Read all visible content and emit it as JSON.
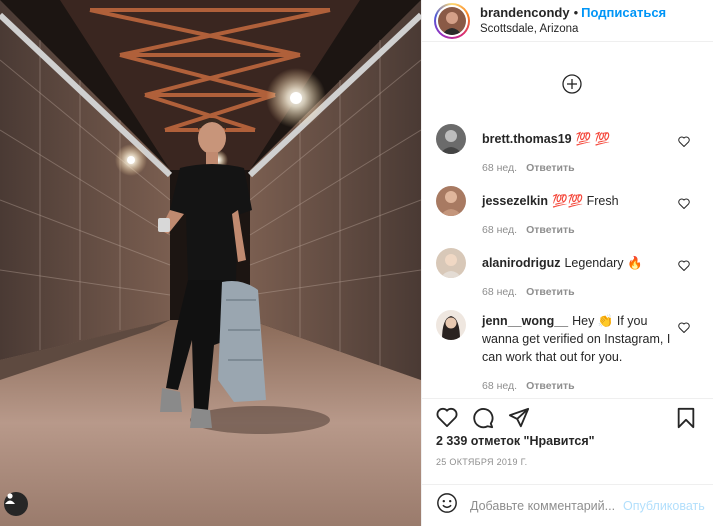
{
  "header": {
    "username": "brandencondy",
    "dot": "•",
    "follow_label": "Подписаться",
    "location": "Scottsdale, Arizona"
  },
  "icons": {
    "load_more": "plus-circle-icon",
    "like": "heart-icon",
    "comment": "comment-icon",
    "share": "paper-plane-icon",
    "save": "bookmark-icon",
    "emoji": "smile-icon",
    "user_tag": "user-tag-icon"
  },
  "comments": [
    {
      "user": "brett.thomas19",
      "text": "💯 💯",
      "age": "68 нед.",
      "reply": "Ответить"
    },
    {
      "user": "jessezelkin",
      "text": "💯💯 Fresh",
      "age": "68 нед.",
      "reply": "Ответить"
    },
    {
      "user": "alanirodriguz",
      "text": "Legendary 🔥",
      "age": "68 нед.",
      "reply": "Ответить"
    },
    {
      "user": "jenn__wong__",
      "text": "Hey 👏 If you wanna get verified on Instagram, I can work that out for you.",
      "age": "68 нед.",
      "reply": "Ответить"
    }
  ],
  "post": {
    "likes": "2 339 отметок \"Нравится\"",
    "date": "25 ОКТЯБРЯ 2019 Г."
  },
  "add_comment": {
    "placeholder": "Добавьте комментарий...",
    "publish_label": "Опубликовать"
  },
  "colors": {
    "accent": "#0095f6",
    "publish_disabled": "#b2dffc",
    "muted": "#8e8e8e",
    "text": "#262626"
  }
}
